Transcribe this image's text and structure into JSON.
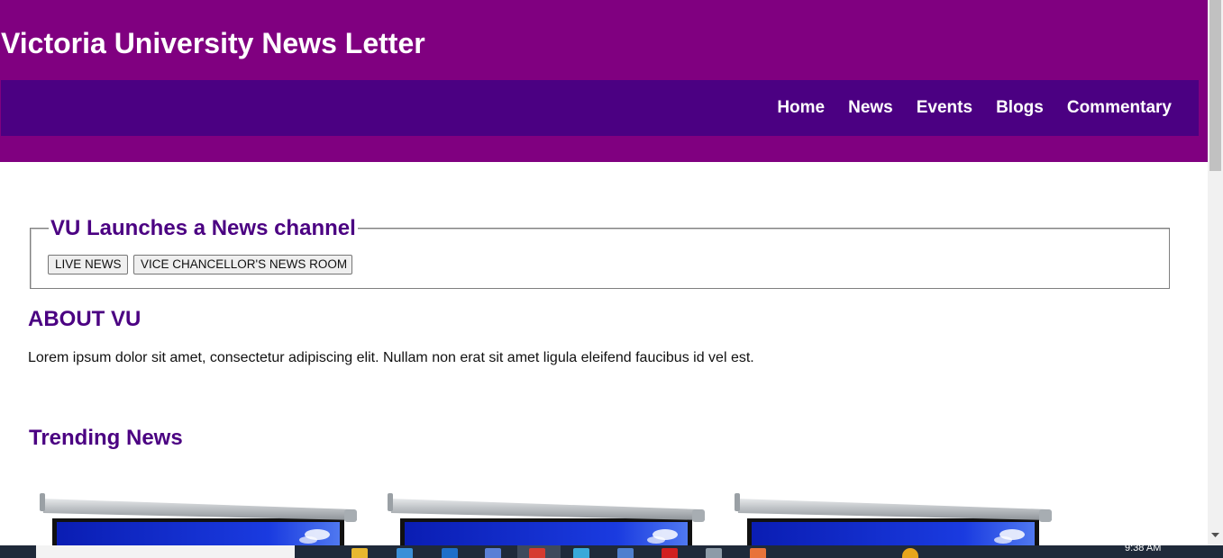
{
  "site": {
    "title": "Victoria University News Letter",
    "nav": [
      {
        "label": "Home"
      },
      {
        "label": "News"
      },
      {
        "label": "Events"
      },
      {
        "label": "Blogs"
      },
      {
        "label": "Commentary"
      }
    ]
  },
  "channel": {
    "legend": "VU Launches a News channel",
    "buttons": {
      "live_news": "LIVE NEWS",
      "vc_news_room": "VICE CHANCELLOR'S NEWS ROOM"
    }
  },
  "about": {
    "heading": "ABOUT VU",
    "text": "Lorem ipsum dolor sit amet, consectetur adipiscing elit. Nullam non erat sit amet ligula eleifend faucibus id vel est."
  },
  "trending": {
    "heading": "Trending News",
    "cards": [
      {
        "image": "projector-screen-image"
      },
      {
        "image": "projector-screen-image"
      },
      {
        "image": "projector-screen-image"
      }
    ]
  },
  "taskbar": {
    "time": "9:38 AM"
  },
  "colors": {
    "header_bg": "#800080",
    "nav_bg": "#4b0082",
    "heading_color": "#4b0082",
    "screen_blue": "#1a2fd6"
  }
}
